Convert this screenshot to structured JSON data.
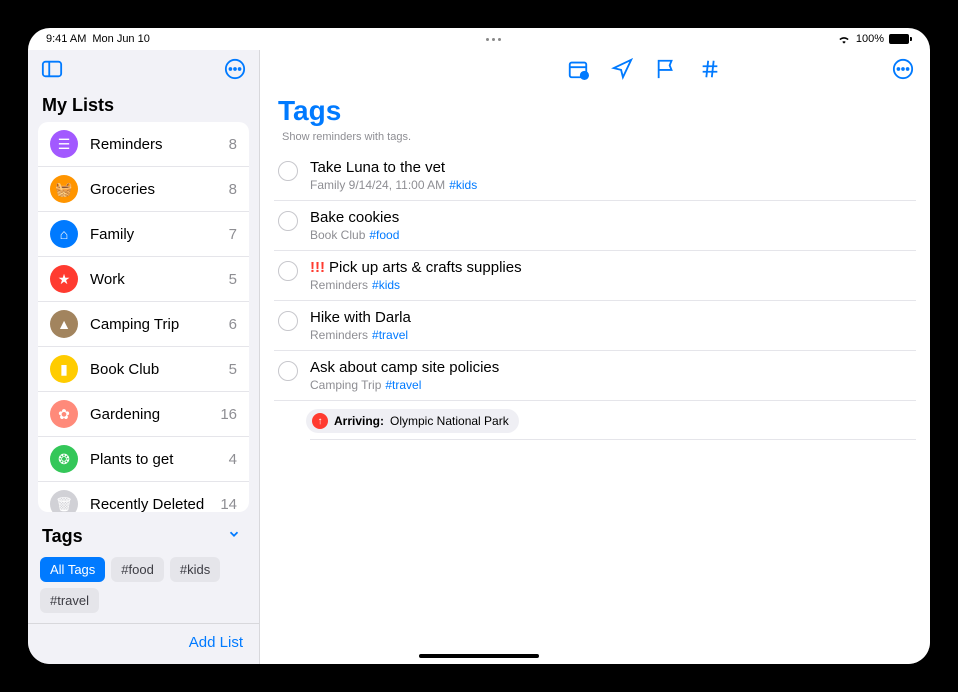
{
  "status": {
    "time": "9:41 AM",
    "date": "Mon Jun 10",
    "battery": "100%"
  },
  "sidebar": {
    "section_title": "My Lists",
    "lists": [
      {
        "name": "Reminders",
        "count": "8",
        "color": "#a259ff",
        "glyph": "☰"
      },
      {
        "name": "Groceries",
        "count": "8",
        "color": "#ff9500",
        "glyph": "🧺"
      },
      {
        "name": "Family",
        "count": "7",
        "color": "#007aff",
        "glyph": "⌂"
      },
      {
        "name": "Work",
        "count": "5",
        "color": "#ff3b30",
        "glyph": "★"
      },
      {
        "name": "Camping Trip",
        "count": "6",
        "color": "#a2845e",
        "glyph": "▲"
      },
      {
        "name": "Book Club",
        "count": "5",
        "color": "#ffcc00",
        "glyph": "▮"
      },
      {
        "name": "Gardening",
        "count": "16",
        "color": "#ff8a7a",
        "glyph": "✿"
      },
      {
        "name": "Plants to get",
        "count": "4",
        "color": "#34c759",
        "glyph": "❂"
      },
      {
        "name": "Recently Deleted",
        "count": "14",
        "color": "#d1d1d6",
        "glyph": "🗑"
      }
    ],
    "tags_title": "Tags",
    "tags": [
      {
        "label": "All Tags",
        "active": true
      },
      {
        "label": "#food",
        "active": false
      },
      {
        "label": "#kids",
        "active": false
      },
      {
        "label": "#travel",
        "active": false
      }
    ],
    "add_list": "Add List"
  },
  "main": {
    "title": "Tags",
    "subtitle": "Show reminders with tags.",
    "reminders": [
      {
        "title": "Take Luna to the vet",
        "list": "Family",
        "due": "9/14/24, 11:00 AM",
        "tag": "#kids",
        "priority": ""
      },
      {
        "title": "Bake cookies",
        "list": "Book Club",
        "due": "",
        "tag": "#food",
        "priority": ""
      },
      {
        "title": "Pick up arts & crafts supplies",
        "list": "Reminders",
        "due": "",
        "tag": "#kids",
        "priority": "!!!"
      },
      {
        "title": "Hike with Darla",
        "list": "Reminders",
        "due": "",
        "tag": "#travel",
        "priority": ""
      },
      {
        "title": "Ask about camp site policies",
        "list": "Camping Trip",
        "due": "",
        "tag": "#travel",
        "priority": "",
        "location_label": "Arriving:",
        "location_value": "Olympic National Park"
      }
    ]
  }
}
